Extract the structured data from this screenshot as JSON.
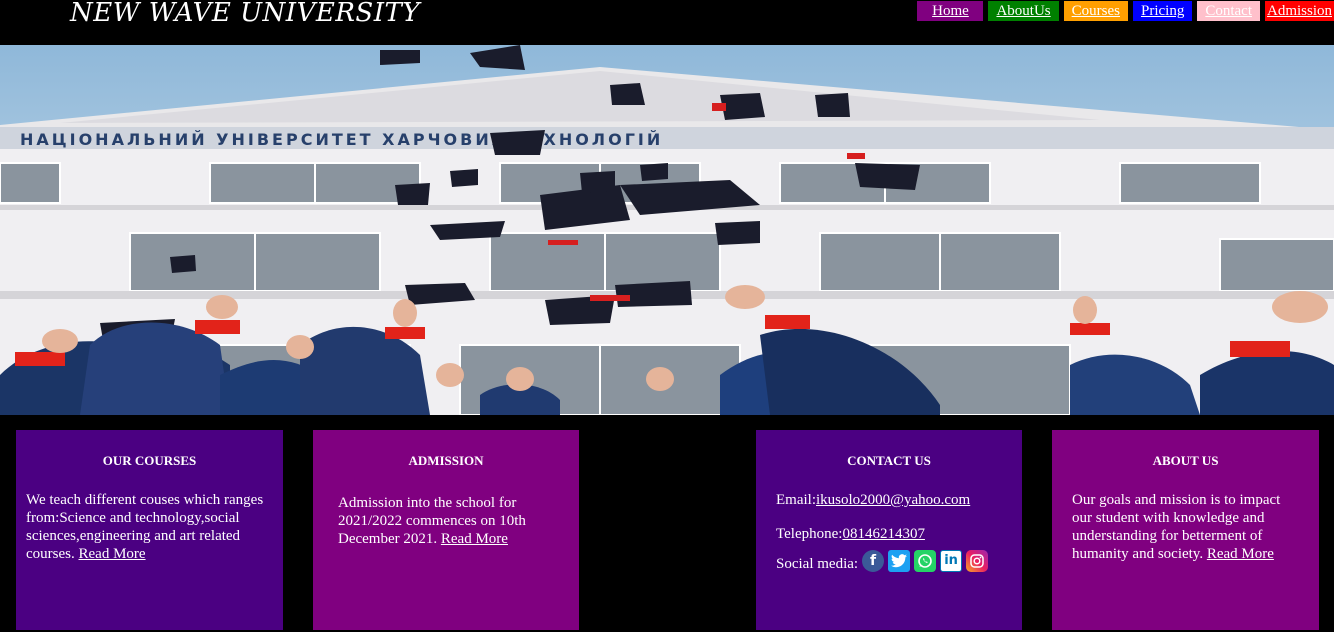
{
  "brand": "NEW WAVE UNIVERSITY",
  "nav": {
    "home": "Home",
    "about": "AboutUs",
    "courses": "Courses",
    "pricing": "Pricing",
    "contact": "Contact",
    "admission": "Admission"
  },
  "courses": {
    "title": "OUR COURSES",
    "text": "We teach different couses which ranges from:Science and technology,social sciences,engineering and art related courses.",
    "link": "Read More"
  },
  "admission": {
    "title": "ADMISSION",
    "text": "Admission into the school for 2021/2022 commences on 10th December 2021.",
    "link": "Read More"
  },
  "contact": {
    "title": "CONTACT US",
    "email_label": "Email:",
    "email": "ikusolo2000@yahoo.com",
    "phone_label": "Telephone:",
    "phone": "08146214307",
    "social_label": "Social media:",
    "icons": [
      "facebook-icon",
      "twitter-icon",
      "whatsapp-icon",
      "linkedin-icon",
      "instagram-icon"
    ]
  },
  "about": {
    "title": "ABOUT US",
    "text": "Our goals and mission is to impact our student with knowledge and understanding for betterment of humanity and society.",
    "link": "Read More"
  },
  "colors": {
    "header_bg": "#000000",
    "card_indigo": "#4b0082",
    "card_purple": "#800080"
  }
}
